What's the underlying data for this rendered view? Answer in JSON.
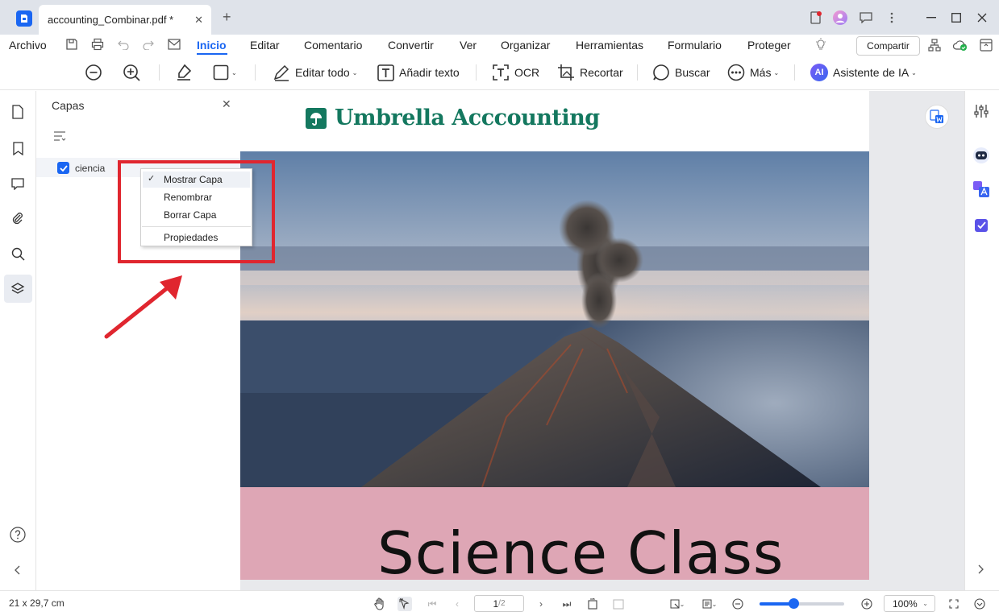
{
  "window": {
    "tab_title": "accounting_Combinar.pdf *"
  },
  "menubar": {
    "archivo": "Archivo",
    "items": [
      "Inicio",
      "Editar",
      "Comentario",
      "Convertir",
      "Ver",
      "Organizar",
      "Herramientas",
      "Formulario",
      "Proteger"
    ],
    "active": "Inicio",
    "share_label": "Compartir"
  },
  "toolbar": {
    "edit_all": "Editar todo",
    "add_text": "Añadir texto",
    "ocr": "OCR",
    "crop": "Recortar",
    "search": "Buscar",
    "more": "Más",
    "ai_badge": "AI",
    "ai_assistant": "Asistente de IA"
  },
  "layers_panel": {
    "title": "Capas",
    "layer_name": "ciencia",
    "layer_checked": true
  },
  "context_menu": {
    "show_layer": "Mostrar Capa",
    "rename": "Renombrar",
    "delete": "Borrar Capa",
    "properties": "Propiedades"
  },
  "document": {
    "brand": "Umbrella Acccounting",
    "headline": "Science Class"
  },
  "statusbar": {
    "page_size": "21 x 29,7 cm",
    "current_page": "1",
    "total_pages": "/2",
    "zoom": "100%",
    "zoom_fraction": 0.4
  },
  "colors": {
    "accent": "#1a66f2",
    "brand_green": "#14785f",
    "annotation_red": "#e0262f",
    "pink_band": "#dea6b5"
  }
}
